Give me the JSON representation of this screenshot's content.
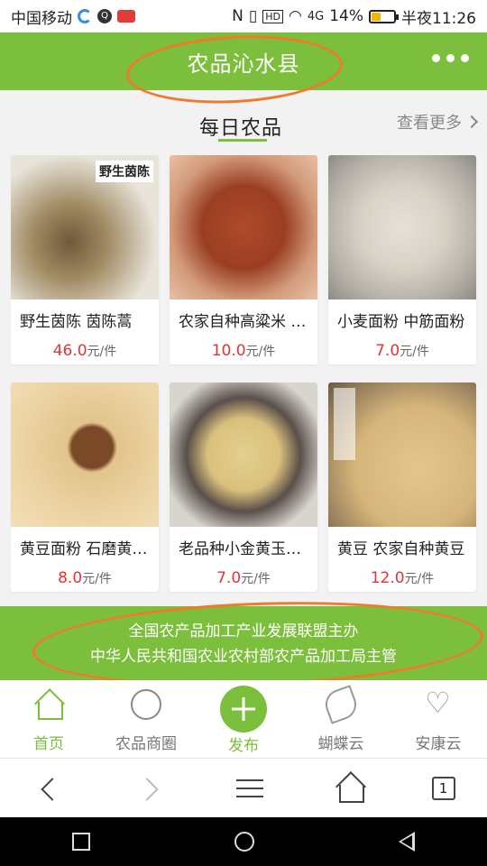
{
  "status": {
    "carrier": "中国移动",
    "battery": "14%",
    "time": "半夜11:26",
    "hd_label": "HD",
    "signal": "4G"
  },
  "header": {
    "title": "农品沁水县"
  },
  "section": {
    "title": "每日农品",
    "see_more": "查看更多"
  },
  "products": [
    {
      "name": "野生茵陈 茵陈蒿",
      "price": "46.0",
      "unit": "元/件",
      "tag": "野生茵陈"
    },
    {
      "name": "农家自种高粱米 红高粱",
      "price": "10.0",
      "unit": "元/件"
    },
    {
      "name": "小麦面粉 中筋面粉",
      "price": "7.0",
      "unit": "元/件"
    },
    {
      "name": "黄豆面粉 石磨黄豆面",
      "price": "8.0",
      "unit": "元/件"
    },
    {
      "name": "老品种小金黄玉米面",
      "price": "7.0",
      "unit": "元/件"
    },
    {
      "name": "黄豆 农家自种黄豆",
      "price": "12.0",
      "unit": "元/件"
    }
  ],
  "banner": {
    "line1": "全国农产品加工产业发展联盟主办",
    "line2": "中华人民共和国农业农村部农产品加工局主管"
  },
  "tabbar": {
    "items": [
      {
        "label": "首页",
        "icon": "home-icon",
        "active": true
      },
      {
        "label": "农品商圈",
        "icon": "ring-icon",
        "active": false
      },
      {
        "label": "发布",
        "icon": "plus-icon",
        "active": true
      },
      {
        "label": "蝴蝶云",
        "icon": "leaf-icon",
        "active": false
      },
      {
        "label": "安康云",
        "icon": "heart-icon",
        "active": false
      }
    ]
  },
  "browser": {
    "tab_count": "1"
  },
  "colors": {
    "brand_green": "#7cbf3c",
    "price_red": "#e03535",
    "annotation_orange": "#f07a2a"
  }
}
